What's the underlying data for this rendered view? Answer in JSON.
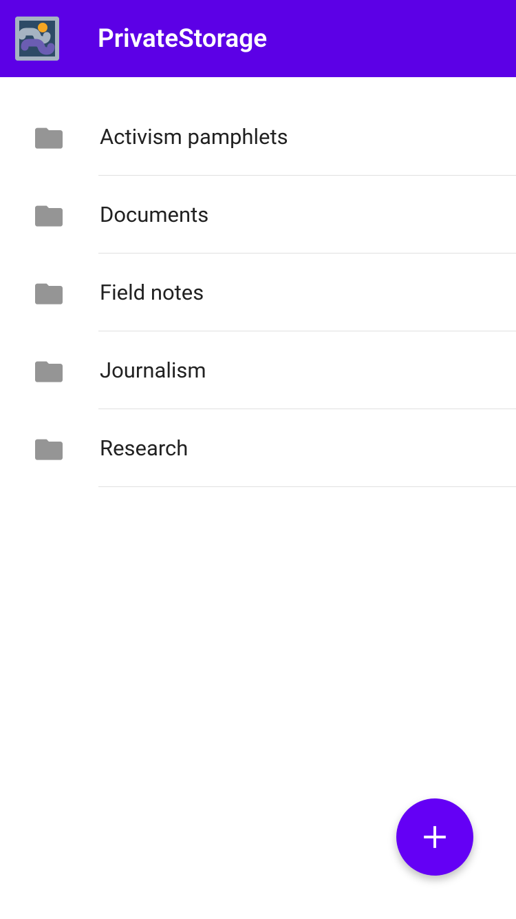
{
  "header": {
    "title": "PrivateStorage"
  },
  "folders": [
    {
      "label": "Activism pamphlets"
    },
    {
      "label": "Documents"
    },
    {
      "label": "Field notes"
    },
    {
      "label": "Journalism"
    },
    {
      "label": "Research"
    }
  ],
  "fab": {
    "label": "Add"
  },
  "colors": {
    "header_bg": "#5c00e6",
    "fab_bg": "#6400f5",
    "folder_icon": "#959595"
  }
}
